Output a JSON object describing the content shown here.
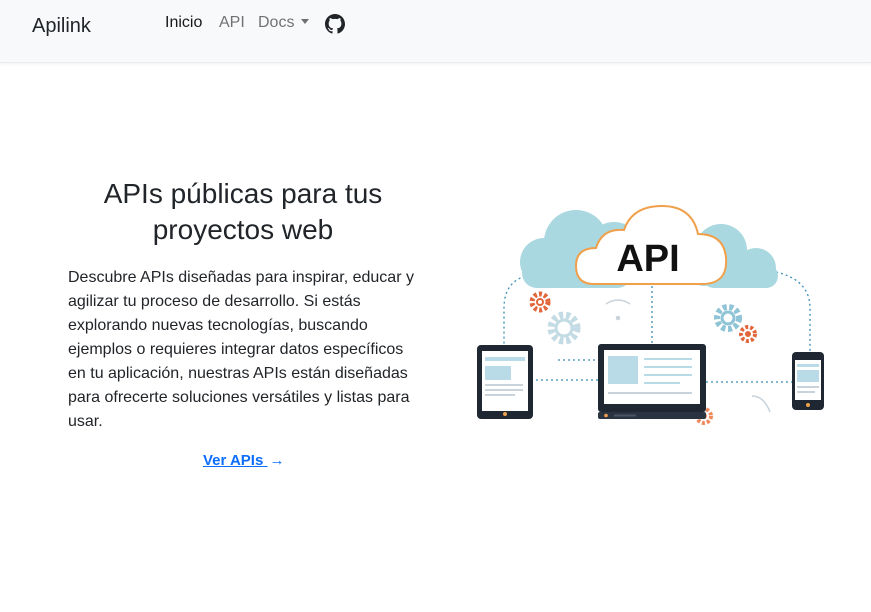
{
  "navbar": {
    "brand": "Apilink",
    "links": [
      {
        "label": "Inicio",
        "active": true
      },
      {
        "label": "API",
        "active": false
      },
      {
        "label": "Docs",
        "active": false,
        "dropdown": true
      }
    ],
    "github_icon": "github-icon"
  },
  "hero": {
    "title": "APIs públicas para tus proyectos web",
    "description": "Descubre APIs diseñadas para inspirar, educar y agilizar tu proceso de desarrollo. Si estás explorando nuevas tecnologías, buscando ejemplos o requieres integrar datos específicos en tu aplicación, nuestras APIs están diseñadas para ofrecerte soluciones versátiles y listas para usar.",
    "cta_label": "Ver APIs",
    "cta_arrow": "→"
  },
  "illustration": {
    "cloud_label": "API",
    "colors": {
      "cloud_blue": "#a9d8e0",
      "cloud_orange": "#f0a04b",
      "device_dark": "#1f2733",
      "screen_blue": "#b9dbe8",
      "gear_blue": "#8fc4d6",
      "gear_orange": "#e2663b",
      "dotted_line": "#3a8fb7"
    }
  }
}
